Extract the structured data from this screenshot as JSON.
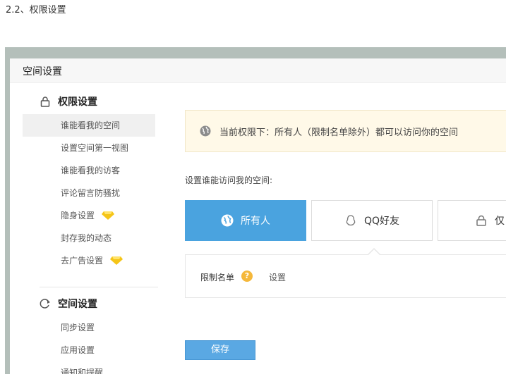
{
  "doc_heading": "2.2、权限设置",
  "window": {
    "title": "空间设置"
  },
  "sidebar": {
    "groups": [
      {
        "label": "权限设置",
        "icon": "lock-icon",
        "items": [
          {
            "label": "谁能看我的空间",
            "active": true
          },
          {
            "label": "设置空间第一视图"
          },
          {
            "label": "谁能看我的访客"
          },
          {
            "label": "评论留言防骚扰"
          },
          {
            "label": "隐身设置",
            "badge": "diamond-icon"
          },
          {
            "label": "封存我的动态"
          },
          {
            "label": "去广告设置",
            "badge": "diamond-icon"
          }
        ]
      },
      {
        "label": "空间设置",
        "icon": "sync-icon",
        "items": [
          {
            "label": "同步设置"
          },
          {
            "label": "应用设置"
          },
          {
            "label": "通知和提醒"
          }
        ]
      }
    ]
  },
  "main": {
    "notice": "当前权限下：所有人（限制名单除外）都可以访问你的空间",
    "section_label": "设置谁能访问我的空间:",
    "options": [
      {
        "label": "所有人",
        "icon": "globe-icon",
        "selected": true
      },
      {
        "label": "QQ好友",
        "icon": "qq-icon"
      },
      {
        "label": "仅自",
        "icon": "lock-icon"
      }
    ],
    "restrict": {
      "label": "限制名单",
      "help": "?",
      "setting": "设置"
    },
    "save_label": "保存"
  },
  "colors": {
    "accent": "#4aa3df",
    "notice_bg": "#fff9e8",
    "diamond": "#f5c518",
    "frame": "#b4bfba"
  }
}
